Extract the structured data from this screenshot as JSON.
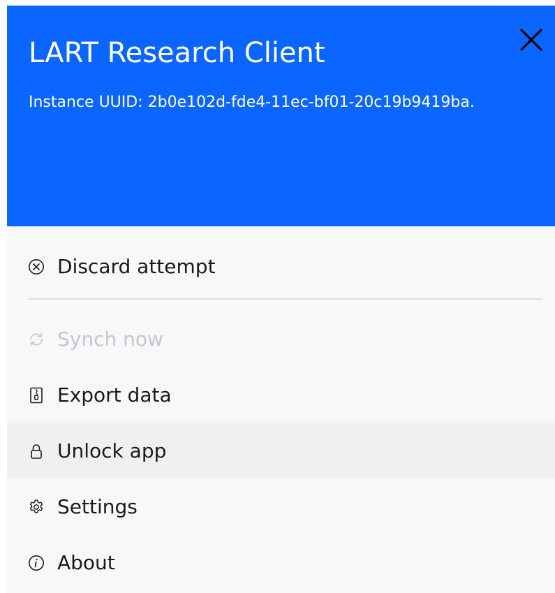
{
  "header": {
    "title": "LART Research Client",
    "uuid_text": "Instance UUID: 2b0e102d-fde4-11ec-bf01-20c19b9419ba.",
    "close_icon": "close-icon",
    "background_color": "#0b66ff",
    "text_color": "#ffffff"
  },
  "menu": {
    "items": [
      {
        "label": "Discard attempt",
        "icon": "circle-x-icon",
        "disabled": false
      },
      {
        "label": "Synch now",
        "icon": "sync-icon",
        "disabled": true
      },
      {
        "label": "Export data",
        "icon": "zip-file-icon",
        "disabled": false
      },
      {
        "label": "Unlock app",
        "icon": "lock-icon",
        "disabled": false,
        "hovered": true
      },
      {
        "label": "Settings",
        "icon": "gear-icon",
        "disabled": false
      },
      {
        "label": "About",
        "icon": "info-icon",
        "disabled": false
      }
    ],
    "disabled_color": "#c4c7cc",
    "hover_color": "#eff0f2"
  }
}
